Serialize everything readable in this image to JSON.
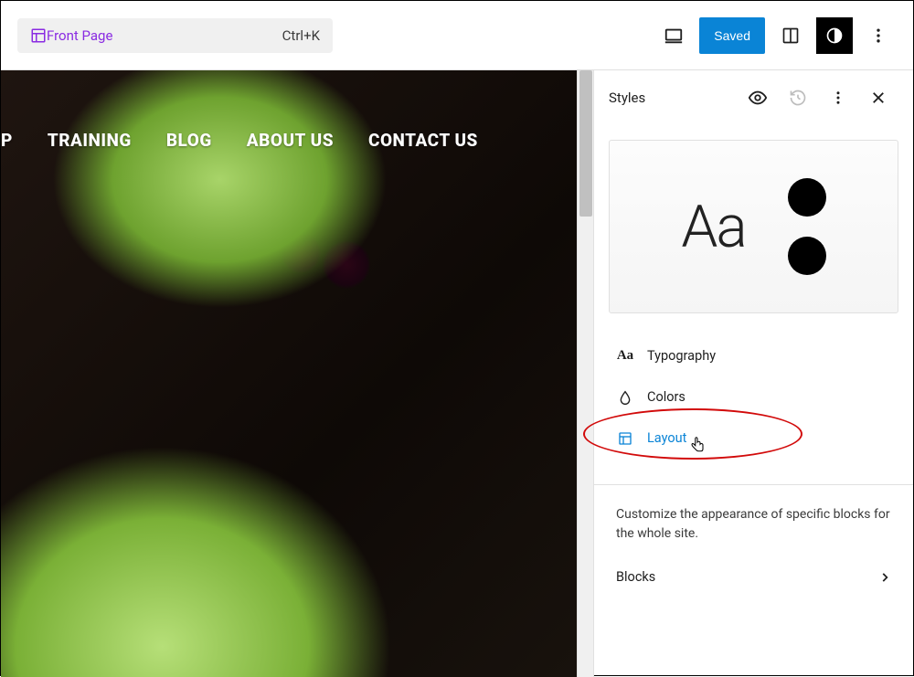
{
  "topbar": {
    "page_name": "Front Page",
    "shortcut": "Ctrl+K",
    "save_label": "Saved"
  },
  "site_nav": {
    "items": [
      "P",
      "TRAINING",
      "BLOG",
      "ABOUT US",
      "CONTACT US"
    ]
  },
  "styles_panel": {
    "title": "Styles",
    "preview_text": "Aa",
    "items": [
      {
        "label": "Typography"
      },
      {
        "label": "Colors"
      },
      {
        "label": "Layout"
      }
    ],
    "blocks_desc": "Customize the appearance of specific blocks for the whole site.",
    "blocks_label": "Blocks"
  }
}
